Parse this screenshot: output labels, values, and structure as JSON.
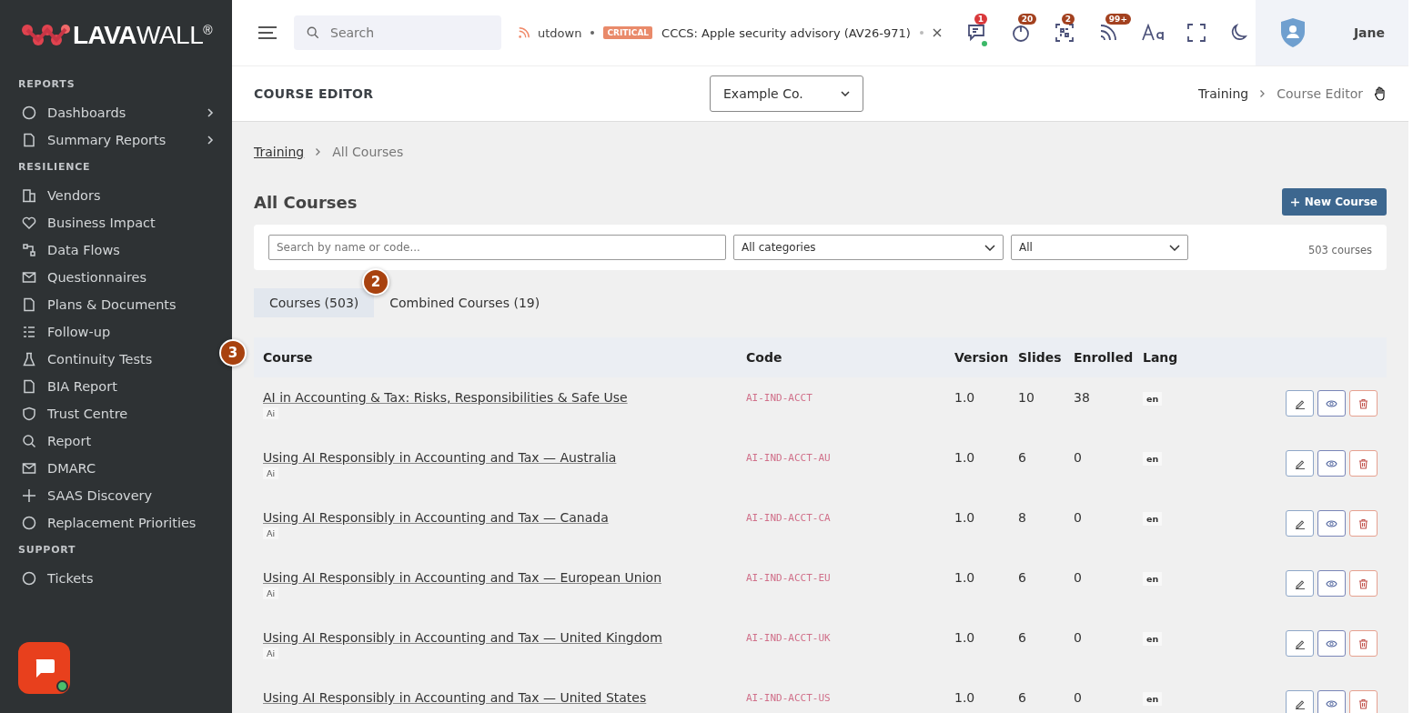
{
  "sidebar": {
    "logo": {
      "text_bold": "LAVA",
      "text_light": "WALL",
      "mark": "®"
    },
    "sections": [
      {
        "title": "REPORTS",
        "items": [
          {
            "label": "Dashboards",
            "has_submenu": true
          },
          {
            "label": "Summary Reports",
            "has_submenu": true
          }
        ]
      },
      {
        "title": "RESILIENCE",
        "items": [
          {
            "label": "Vendors",
            "has_submenu": false
          },
          {
            "label": "Business Impact",
            "has_submenu": false
          },
          {
            "label": "Data Flows",
            "has_submenu": false
          },
          {
            "label": "Questionnaires",
            "has_submenu": false
          },
          {
            "label": "Plans & Documents",
            "has_submenu": false
          },
          {
            "label": "Follow-up",
            "has_submenu": false
          },
          {
            "label": "Continuity Tests",
            "has_submenu": false
          },
          {
            "label": "BIA Report",
            "has_submenu": false
          },
          {
            "label": "Trust Centre",
            "has_submenu": false
          },
          {
            "label": "Report",
            "has_submenu": false
          },
          {
            "label": "DMARC",
            "has_submenu": false
          },
          {
            "label": "SAAS Discovery",
            "has_submenu": false
          },
          {
            "label": "Replacement Priorities",
            "has_submenu": false
          }
        ]
      },
      {
        "title": "SUPPORT",
        "items": [
          {
            "label": "Tickets",
            "has_submenu": false
          }
        ]
      }
    ]
  },
  "topbar": {
    "search": {
      "placeholder": "Search"
    },
    "ticker": {
      "prev_text": "utdown",
      "severity": "CRITICAL",
      "text": "CCCS: Apple security advisory (AV26-971)"
    },
    "notifications": [
      {
        "kind": "chat",
        "count": "1",
        "color": "#d9393b"
      },
      {
        "kind": "timer",
        "count": "20",
        "color": "#a3411f"
      },
      {
        "kind": "qr",
        "count": "2",
        "color": "#a3411f"
      },
      {
        "kind": "feed",
        "count": "99+",
        "color": "#a3411f"
      }
    ],
    "user": {
      "name": "Jane"
    }
  },
  "header": {
    "title": "COURSE EDITOR",
    "company": "Example Co.",
    "breadcrumb": [
      "Training",
      "Course Editor"
    ]
  },
  "breadcrumb": [
    "Training",
    "All Courses"
  ],
  "page_title": "All Courses",
  "new_button": "New Course",
  "filters": {
    "search": {
      "placeholder": "Search by name or code..."
    },
    "category": "All categories",
    "status": "All",
    "count": "503 courses"
  },
  "tour_steps": [
    "2",
    "3"
  ],
  "tabs": [
    {
      "label": "Courses (503)",
      "selected": true
    },
    {
      "label": "Combined Courses (19)",
      "selected": false
    }
  ],
  "table": {
    "columns": [
      "Course",
      "Code",
      "Version",
      "Slides",
      "Enrolled",
      "Lang"
    ],
    "rows": [
      {
        "title": "AI in Accounting & Tax: Risks, Responsibilities & Safe Use",
        "tag": "Ai",
        "code": "AI-IND-ACCT",
        "version": "1.0",
        "slides": "10",
        "enrolled": "38",
        "lang": "en"
      },
      {
        "title": "Using AI Responsibly in Accounting and Tax — Australia",
        "tag": "Ai",
        "code": "AI-IND-ACCT-AU",
        "version": "1.0",
        "slides": "6",
        "enrolled": "0",
        "lang": "en"
      },
      {
        "title": "Using AI Responsibly in Accounting and Tax — Canada",
        "tag": "Ai",
        "code": "AI-IND-ACCT-CA",
        "version": "1.0",
        "slides": "8",
        "enrolled": "0",
        "lang": "en"
      },
      {
        "title": "Using AI Responsibly in Accounting and Tax — European Union",
        "tag": "Ai",
        "code": "AI-IND-ACCT-EU",
        "version": "1.0",
        "slides": "6",
        "enrolled": "0",
        "lang": "en"
      },
      {
        "title": "Using AI Responsibly in Accounting and Tax — United Kingdom",
        "tag": "Ai",
        "code": "AI-IND-ACCT-UK",
        "version": "1.0",
        "slides": "6",
        "enrolled": "0",
        "lang": "en"
      },
      {
        "title": "Using AI Responsibly in Accounting and Tax — United States",
        "code": "AI-IND-ACCT-US",
        "version": "1.0",
        "slides": "6",
        "enrolled": "0",
        "lang": "en"
      }
    ]
  }
}
